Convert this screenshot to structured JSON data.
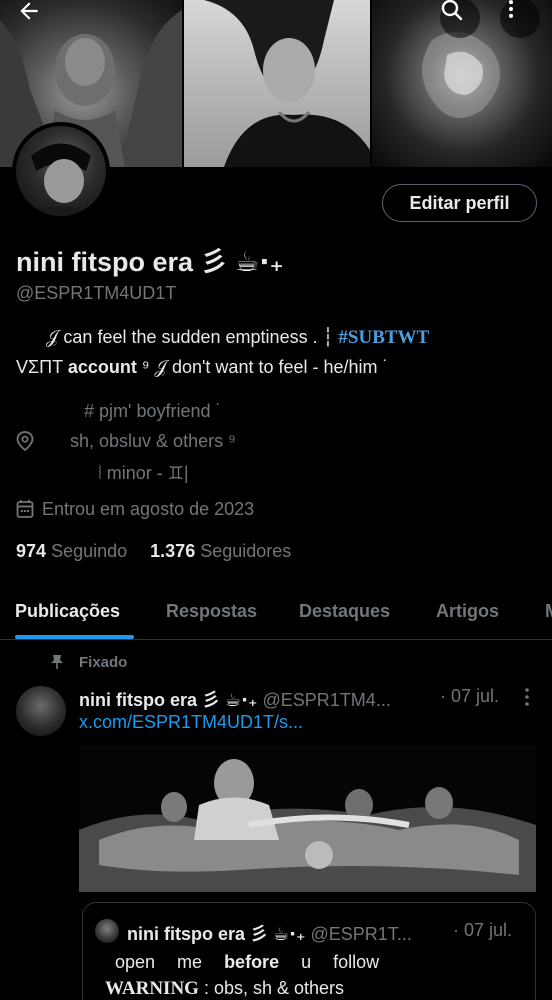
{
  "profile": {
    "display_name": "nini fitspo era 彡 ☕︎⋅₊",
    "handle": "@ESPR1TM4UD1T",
    "edit_button": "Editar perfil",
    "bio_line1_text": "𝒥 can feel the sudden emptiness . ┆ ",
    "bio_line1_tag": "#SUBTWT",
    "bio_line2_a": "VΣΠT ",
    "bio_line2_bold": "account",
    "bio_line2_b": " ⁹ 𝒥 don't want to feel  - he/him ˙",
    "location_line1": "#  pjm' boyfriend ˙",
    "location_line2": "sh, obsluv & others ⁹",
    "location_line3": "⦚    minor  - ♊|",
    "joined": "Entrou em agosto de 2023",
    "following_count": "974",
    "following_label": "Seguindo",
    "followers_count": "1.376",
    "followers_label": "Seguidores"
  },
  "tabs": [
    "Publicações",
    "Respostas",
    "Destaques",
    "Artigos",
    "M"
  ],
  "pinned": {
    "label": "Fixado",
    "name": "nini fitspo era 彡 ☕︎⋅₊",
    "handle": "@ESPR1TM4...",
    "date": "· 07 jul.",
    "link": "x.com/ESPR1TM4UD1T/s...",
    "quote": {
      "name": "nini fitspo era 彡 ☕︎⋅₊",
      "handle": "@ESPR1T...",
      "date": "· 07 jul.",
      "line1_a": "open  me  ",
      "line1_bold": "before",
      "line1_b": "  u  follow",
      "warning": "WARNING",
      "line2_rest": " : obs, sh & others"
    }
  },
  "icons": {
    "back": "back-arrow-icon",
    "search": "search-icon",
    "more": "more-vertical-icon",
    "location": "location-pin-icon",
    "calendar": "calendar-icon",
    "pin": "pin-icon"
  },
  "colors": {
    "background": "#000000",
    "text": "#e7e9ea",
    "secondary": "#71767b",
    "accent": "#1d9bf0",
    "border": "#2f3336"
  }
}
